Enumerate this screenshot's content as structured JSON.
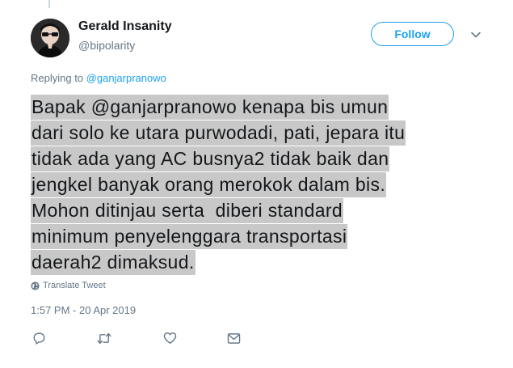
{
  "user": {
    "display_name": "Gerald Insanity",
    "handle": "@bipolarity"
  },
  "follow_label": "Follow",
  "reply_context": {
    "prefix": "Replying to ",
    "mention": "@ganjarpranowo"
  },
  "tweet": {
    "lines": [
      "Bapak @ganjarpranowo kenapa bis umun",
      "dari solo ke utara purwodadi, pati, jepara itu",
      "tidak ada yang AC busnya2 tidak baik dan",
      "jengkel banyak orang merokok dalam bis.",
      "Mohon ditinjau serta  diberi standard",
      "minimum penyelenggara transportasi",
      "daerah2 dimaksud."
    ],
    "highlight_color": "#c8c8c8"
  },
  "translate_label": "Translate Tweet",
  "timestamp": "1:57 PM - 20 Apr 2019",
  "actions": {
    "reply_icon": "reply-icon",
    "retweet_icon": "retweet-icon",
    "like_icon": "heart-icon",
    "dm_icon": "envelope-icon"
  },
  "colors": {
    "accent": "#1da1f2",
    "muted": "#657786",
    "text": "#14171a"
  }
}
